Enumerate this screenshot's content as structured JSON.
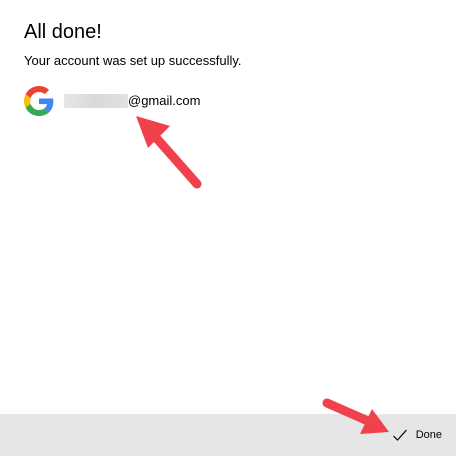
{
  "header": {
    "title": "All done!",
    "subtitle": "Your account was set up successfully."
  },
  "account": {
    "provider_icon": "google-logo",
    "email_suffix": "@gmail.com"
  },
  "footer": {
    "done_label": "Done",
    "done_icon": "checkmark"
  },
  "colors": {
    "annotation_arrow": "#f0414c",
    "footer_background": "#e6e6e6",
    "google_blue": "#4285F4",
    "google_red": "#EA4335",
    "google_yellow": "#FBBC05",
    "google_green": "#34A853"
  }
}
